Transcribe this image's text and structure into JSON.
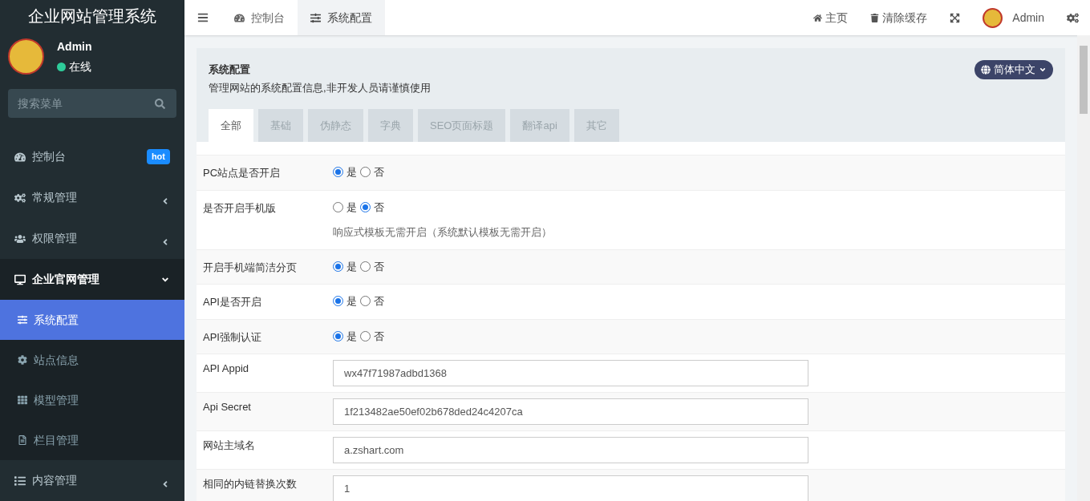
{
  "brand": "企业网站管理系统",
  "user": {
    "name": "Admin",
    "status": "在线"
  },
  "search": {
    "placeholder": "搜索菜单"
  },
  "menu": [
    {
      "kind": "link",
      "label": "控制台",
      "badge": "hot"
    },
    {
      "kind": "group",
      "label": "常规管理",
      "expanded": false
    },
    {
      "kind": "group",
      "label": "权限管理",
      "expanded": false
    },
    {
      "kind": "group",
      "label": "企业官网管理",
      "expanded": true,
      "children": [
        {
          "label": "系统配置",
          "selected": true
        },
        {
          "label": "站点信息",
          "selected": false
        },
        {
          "label": "模型管理",
          "selected": false
        },
        {
          "label": "栏目管理",
          "selected": false
        }
      ]
    },
    {
      "kind": "group",
      "label": "内容管理",
      "expanded": false
    }
  ],
  "top_tabs": [
    {
      "label": "控制台",
      "selected": false
    },
    {
      "label": "系统配置",
      "selected": true
    }
  ],
  "top_links": [
    {
      "label": "主页"
    },
    {
      "label": "清除缓存"
    }
  ],
  "top_user": "Admin",
  "panel": {
    "title": "系统配置",
    "description": "管理网站的系统配置信息,非开发人员请谨慎使用",
    "language": "简体中文"
  },
  "config_tabs": [
    {
      "label": "全部",
      "selected": true
    },
    {
      "label": "基础",
      "selected": false
    },
    {
      "label": "伪静态",
      "selected": false
    },
    {
      "label": "字典",
      "selected": false
    },
    {
      "label": "SEO页面标题",
      "selected": false
    },
    {
      "label": "翻译api",
      "selected": false
    },
    {
      "label": "其它",
      "selected": false
    }
  ],
  "rows": [
    {
      "kind": "radio",
      "label": "PC站点是否开启",
      "options": [
        {
          "label": "是",
          "selected": true
        },
        {
          "label": "否",
          "selected": false
        }
      ]
    },
    {
      "kind": "radio",
      "label": "是否开启手机版",
      "options": [
        {
          "label": "是",
          "selected": false
        },
        {
          "label": "否",
          "selected": true
        }
      ],
      "hint": "响应式模板无需开启（系统默认模板无需开启）"
    },
    {
      "kind": "radio",
      "label": "开启手机端简洁分页",
      "options": [
        {
          "label": "是",
          "selected": true
        },
        {
          "label": "否",
          "selected": false
        }
      ]
    },
    {
      "kind": "radio",
      "label": "API是否开启",
      "options": [
        {
          "label": "是",
          "selected": true
        },
        {
          "label": "否",
          "selected": false
        }
      ]
    },
    {
      "kind": "radio",
      "label": "API强制认证",
      "options": [
        {
          "label": "是",
          "selected": true
        },
        {
          "label": "否",
          "selected": false
        }
      ]
    },
    {
      "kind": "text",
      "label": "API Appid",
      "value": "wx47f71987adbd1368"
    },
    {
      "kind": "text",
      "label": "Api Secret",
      "value": "1f213482ae50ef02b678ded24c4207ca"
    },
    {
      "kind": "text",
      "label": "网站主域名",
      "value": "a.zshart.com"
    },
    {
      "kind": "text",
      "label": "相同的内链替换次数",
      "value": "1"
    }
  ]
}
